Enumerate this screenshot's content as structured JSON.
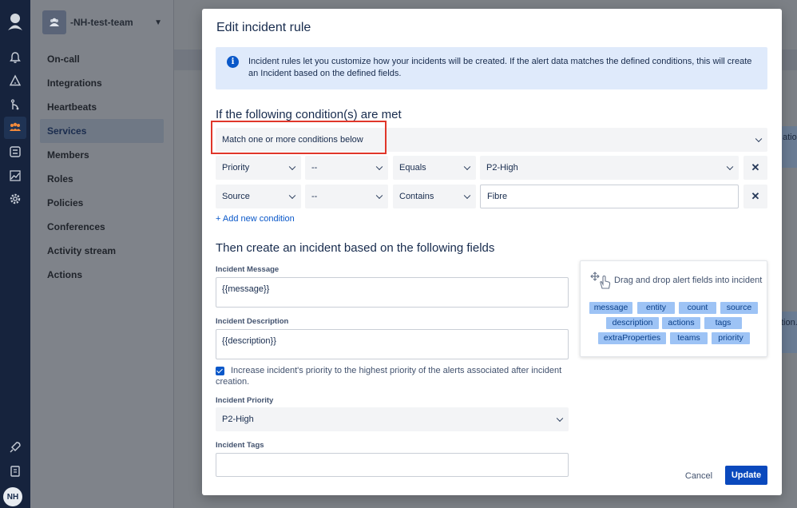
{
  "team": {
    "name": "-NH-test-team"
  },
  "nav": {
    "items": [
      {
        "label": "On-call"
      },
      {
        "label": "Integrations"
      },
      {
        "label": "Heartbeats"
      },
      {
        "label": "Services"
      },
      {
        "label": "Members"
      },
      {
        "label": "Roles"
      },
      {
        "label": "Policies"
      },
      {
        "label": "Conferences"
      },
      {
        "label": "Activity stream"
      },
      {
        "label": "Actions"
      }
    ],
    "selected": "Services"
  },
  "user": {
    "initials": "NH"
  },
  "background": {
    "fragment_top": "ation",
    "fragment_mid": "tion."
  },
  "modal": {
    "title": "Edit incident rule",
    "info_text": "Incident rules let you customize how your incidents will be created. If the alert data matches the defined conditions, this will create an Incident based on the defined fields.",
    "conditions_heading": "If the following condition(s) are met",
    "match_mode": "Match one or more conditions below",
    "conditions": [
      {
        "field": "Priority",
        "sub": "--",
        "operator": "Equals",
        "value": "P2-High"
      },
      {
        "field": "Source",
        "sub": "--",
        "operator": "Contains",
        "value": "Fibre"
      }
    ],
    "add_condition": "+ Add new condition",
    "fields_heading": "Then create an incident based on the following fields",
    "incident_message": {
      "label": "Incident Message",
      "value": "{{message}}"
    },
    "incident_description": {
      "label": "Incident Description",
      "value": "{{description}}"
    },
    "increase_priority": {
      "checked": true,
      "text": "Increase incident's priority to the highest priority of the alerts associated after incident creation."
    },
    "incident_priority": {
      "label": "Incident Priority",
      "value": "P2-High"
    },
    "incident_tags": {
      "label": "Incident Tags"
    },
    "drag_panel": {
      "title": "Drag and drop alert fields into incident",
      "chips": [
        "message",
        "entity",
        "count",
        "source",
        "description",
        "actions",
        "tags",
        "extraProperties",
        "teams",
        "priority"
      ]
    },
    "cancel": "Cancel",
    "update": "Update"
  },
  "colors": {
    "primary": "#0a49bd",
    "highlight_border": "#e0362a",
    "info_bg": "#dfeafb",
    "chip_bg": "#9dc3f5"
  }
}
